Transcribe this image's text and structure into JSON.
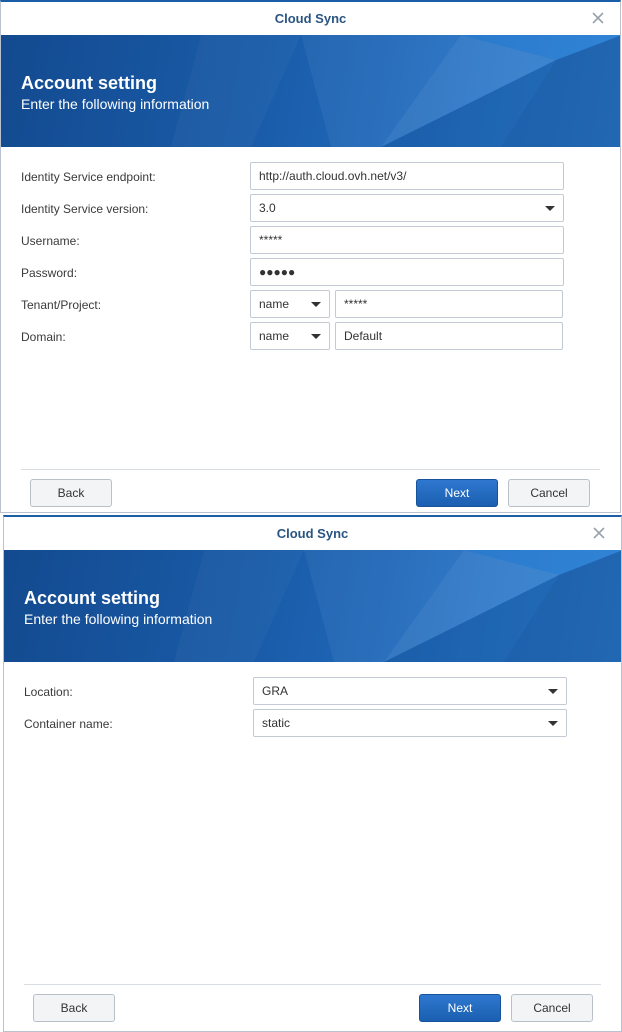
{
  "dialog1": {
    "title": "Cloud Sync",
    "banner": {
      "title": "Account setting",
      "subtitle": "Enter the following information"
    },
    "fields": {
      "endpoint": {
        "label": "Identity Service endpoint:",
        "value": "http://auth.cloud.ovh.net/v3/"
      },
      "version": {
        "label": "Identity Service version:",
        "value": "3.0"
      },
      "username": {
        "label": "Username:",
        "value": "*****"
      },
      "password": {
        "label": "Password:",
        "value": "●●●●●"
      },
      "tenant": {
        "label": "Tenant/Project:",
        "type_value": "name",
        "value": "*****"
      },
      "domain": {
        "label": "Domain:",
        "type_value": "name",
        "value": "Default"
      }
    },
    "buttons": {
      "back": "Back",
      "next": "Next",
      "cancel": "Cancel"
    }
  },
  "dialog2": {
    "title": "Cloud Sync",
    "banner": {
      "title": "Account setting",
      "subtitle": "Enter the following information"
    },
    "fields": {
      "location": {
        "label": "Location:",
        "value": "GRA"
      },
      "container": {
        "label": "Container name:",
        "value": "static"
      }
    },
    "buttons": {
      "back": "Back",
      "next": "Next",
      "cancel": "Cancel"
    }
  },
  "colors": {
    "accent": "#1a5fb0",
    "title_text": "#2a5582",
    "banner": "#1a5dab"
  },
  "icons": {
    "close": "close-icon",
    "dropdown": "chevron-down-icon"
  }
}
